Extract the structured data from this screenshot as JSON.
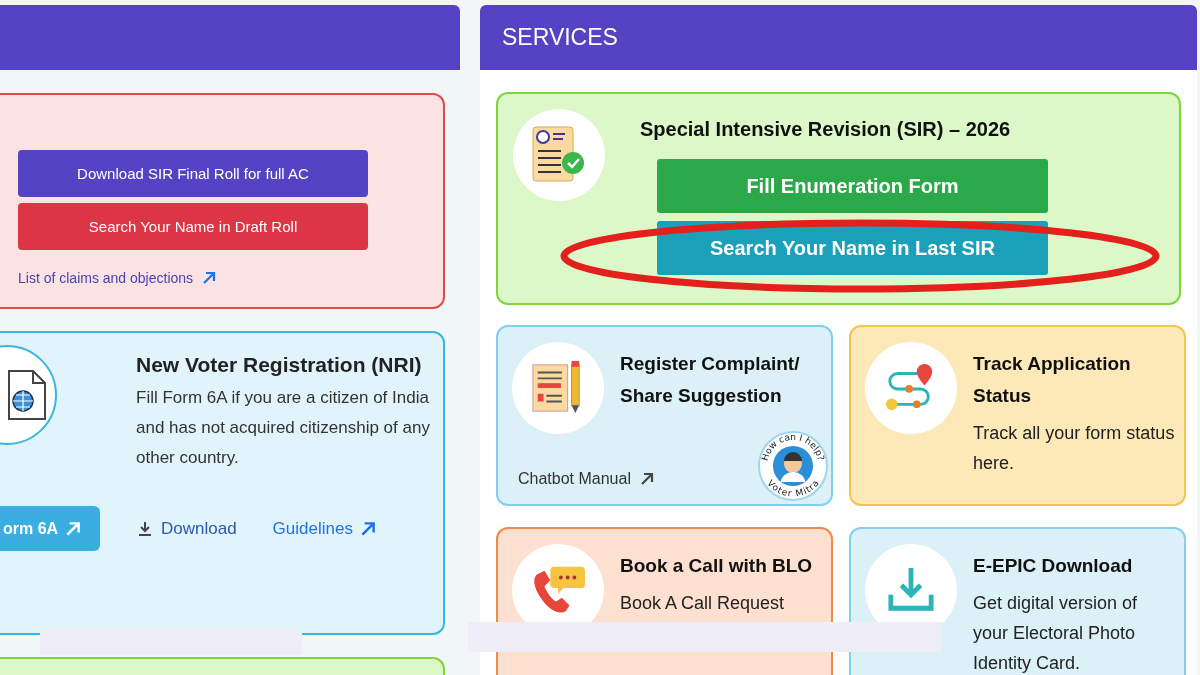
{
  "left_panel": {
    "cards": [
      {
        "kind": "roll",
        "buttons": [
          {
            "label": "Download SIR Final Roll for full AC",
            "kind": "primary"
          },
          {
            "label": "Search Your Name in Draft Roll",
            "kind": "danger"
          }
        ],
        "link": "List of claims and objections"
      },
      {
        "kind": "nri",
        "title": "New Voter Registration (NRI)",
        "description": "Fill Form 6A if you are a citizen of India and has not acquired citizenship of any other country.",
        "button": "orm 6A",
        "download": "Download",
        "guidelines": "Guidelines"
      },
      {
        "kind": "partial"
      }
    ]
  },
  "services": {
    "title": "SERVICES",
    "sir": {
      "title": "Special Intensive Revision (SIR) – 2026",
      "buttons": [
        {
          "label": "Fill Enumeration Form",
          "kind": "primary",
          "highlighted": false
        },
        {
          "label": "Search Your Name in Last SIR",
          "kind": "secondary",
          "highlighted": true
        }
      ]
    },
    "cards": [
      {
        "kind": "complaint",
        "color": "#7fd0ee",
        "title": "Register Complaint/ Share Suggestion",
        "link": "Chatbot Manual",
        "badge": {
          "top": "How can I help?",
          "bottom": "Voter Mitra"
        }
      },
      {
        "kind": "track",
        "color": "#f3c44e",
        "title": "Track Application Status",
        "description": "Track all your form status here."
      },
      {
        "kind": "call",
        "color": "#ee8a4a",
        "title": "Book a Call with BLO",
        "description": "Book A Call Request"
      },
      {
        "kind": "epic",
        "color": "#7fd0ee",
        "title": "E-EPIC Download",
        "description": "Get digital version of your Electoral Photo Identity Card."
      }
    ]
  }
}
